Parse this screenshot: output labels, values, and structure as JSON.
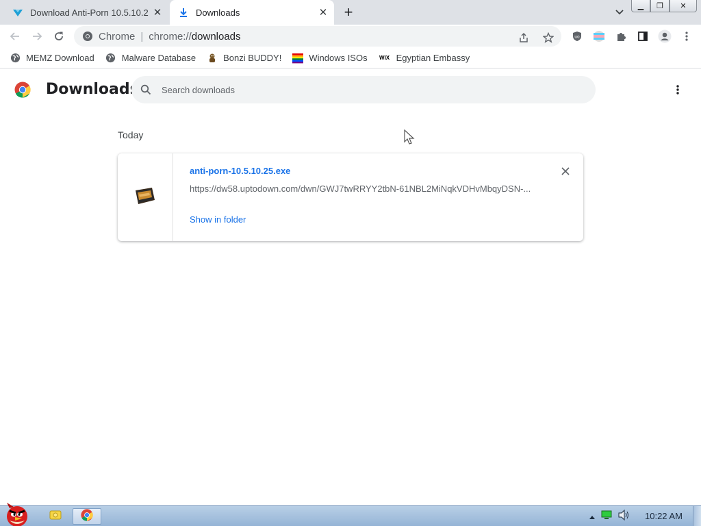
{
  "browser": {
    "tabs": [
      {
        "title": "Download Anti-Porn 10.5.10.2",
        "icon": "uptodown-icon",
        "active": false
      },
      {
        "title": "Downloads",
        "icon": "download-icon",
        "active": true
      }
    ],
    "omnibox": {
      "scheme_label": "Chrome",
      "url_host": "chrome://",
      "url_path": "downloads"
    },
    "bookmarks": [
      {
        "label": "MEMZ Download",
        "icon": "globe-icon"
      },
      {
        "label": "Malware Database",
        "icon": "globe-icon"
      },
      {
        "label": "Bonzi BUDDY!",
        "icon": "bonzi-icon"
      },
      {
        "label": "Windows ISOs",
        "icon": "rainbow-flag-icon"
      },
      {
        "label": "Egyptian Embassy",
        "icon": "wix-icon"
      }
    ],
    "wix_glyph": "WIX"
  },
  "downloads_page": {
    "title": "Downloads",
    "search_placeholder": "Search downloads",
    "section_label": "Today",
    "items": [
      {
        "file_name": "anti-porn-10.5.10.25.exe",
        "url": "https://dw58.uptodown.com/dwn/GWJ7twRRYY2tbN-61NBL2MiNqkVDHvMbqyDSN-...",
        "action_label": "Show in folder"
      }
    ]
  },
  "taskbar": {
    "clock": "10:22 AM"
  },
  "colors": {
    "link": "#1a73e8",
    "tabstrip": "#dee1e6",
    "omnibox": "#f1f3f4"
  }
}
